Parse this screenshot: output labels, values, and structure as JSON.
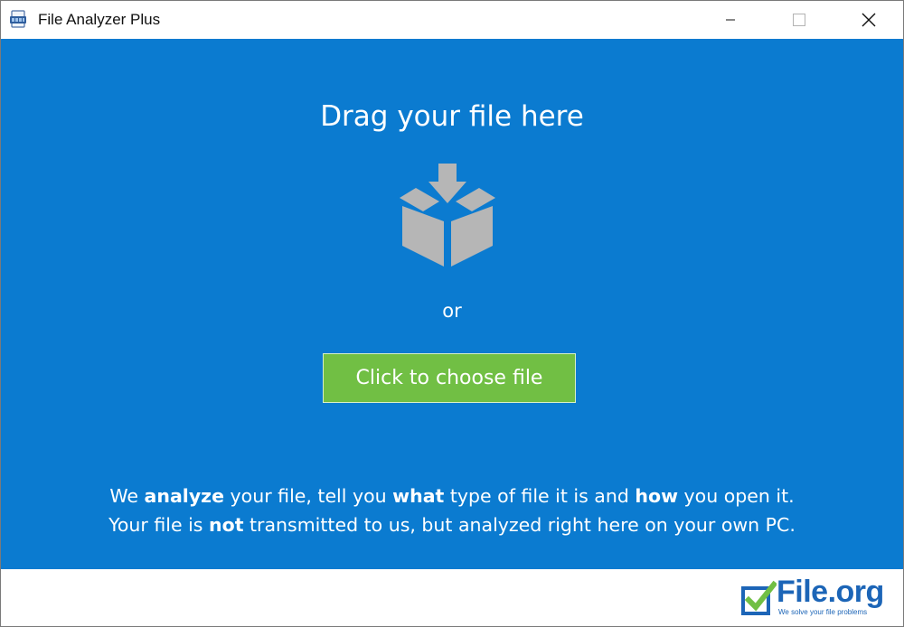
{
  "window": {
    "title": "File Analyzer Plus",
    "controls": {
      "minimize_icon": "minimize-icon",
      "maximize_icon": "maximize-icon",
      "close_icon": "close-icon"
    }
  },
  "main": {
    "background": "#0b7bd0",
    "drag_title": "Drag your file here",
    "drop_icon": "box-download-icon",
    "or_text": "or",
    "choose_button": {
      "label": "Click to choose file",
      "color": "#71bf44"
    },
    "info_line1": {
      "p1": "We ",
      "b1": "analyze",
      "p2": " your file, tell you ",
      "b2": "what",
      "p3": " type of file it is and ",
      "b3": "how",
      "p4": " you open it."
    },
    "info_line2": {
      "p1": "Your file is ",
      "b1": "not",
      "p2": " transmitted to us, but analyzed right here on your own PC."
    }
  },
  "footer": {
    "logo": {
      "icon": "checkbox-check-icon",
      "word_main": "File",
      "word_dot_org": ".org",
      "tagline": "We solve your file problems"
    }
  }
}
